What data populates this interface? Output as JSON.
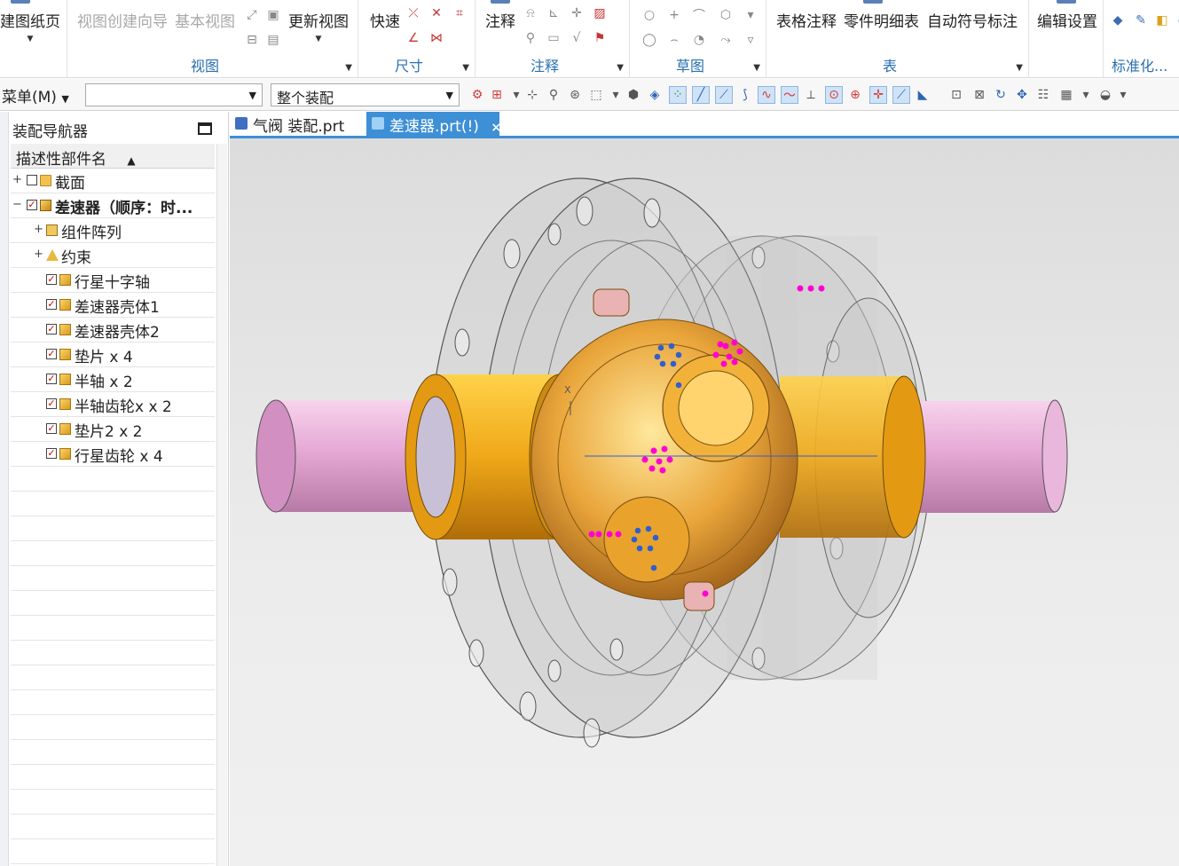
{
  "ribbon": {
    "groups": [
      {
        "label": "",
        "buttons": [
          "建图纸页"
        ]
      },
      {
        "label": "视图",
        "buttons": [
          "视图创建向导",
          "基本视图",
          "更新视图"
        ]
      },
      {
        "label": "尺寸",
        "buttons": [
          "快速"
        ]
      },
      {
        "label": "注释",
        "buttons": [
          "注释"
        ]
      },
      {
        "label": "草图",
        "buttons": []
      },
      {
        "label": "表",
        "buttons": [
          "表格注释",
          "零件明细表",
          "自动符号标注"
        ]
      },
      {
        "label": "",
        "buttons": [
          "编辑设置"
        ]
      },
      {
        "label": "标准化...",
        "buttons": []
      }
    ]
  },
  "toolbar": {
    "menu_label": "菜单(M)",
    "filter_value": "",
    "scope_value": "整个装配"
  },
  "navigator": {
    "title": "装配导航器",
    "column_header": "描述性部件名",
    "items": [
      {
        "label": "截面",
        "level": 0,
        "expander": "+",
        "checked": false,
        "icon": "folder",
        "bold": false
      },
      {
        "label": "差速器（顺序：时...",
        "level": 0,
        "expander": "−",
        "checked": true,
        "icon": "asm",
        "bold": true
      },
      {
        "label": "组件阵列",
        "level": 1,
        "expander": "+",
        "checked": null,
        "icon": "arr",
        "bold": false
      },
      {
        "label": "约束",
        "level": 1,
        "expander": "+",
        "checked": null,
        "icon": "cons",
        "bold": false
      },
      {
        "label": "行星十字轴",
        "level": 1,
        "expander": "",
        "checked": true,
        "icon": "cube",
        "bold": false
      },
      {
        "label": "差速器壳体1",
        "level": 1,
        "expander": "",
        "checked": true,
        "icon": "cube",
        "bold": false
      },
      {
        "label": "差速器壳体2",
        "level": 1,
        "expander": "",
        "checked": true,
        "icon": "cube",
        "bold": false
      },
      {
        "label": "垫片 x 4",
        "level": 1,
        "expander": "",
        "checked": true,
        "icon": "cube",
        "bold": false
      },
      {
        "label": "半轴 x 2",
        "level": 1,
        "expander": "",
        "checked": true,
        "icon": "cube",
        "bold": false
      },
      {
        "label": "半轴齿轮x x 2",
        "level": 1,
        "expander": "",
        "checked": true,
        "icon": "cube",
        "bold": false
      },
      {
        "label": "垫片2 x 2",
        "level": 1,
        "expander": "",
        "checked": true,
        "icon": "cube",
        "bold": false
      },
      {
        "label": "行星齿轮 x 4",
        "level": 1,
        "expander": "",
        "checked": true,
        "icon": "cube",
        "bold": false
      }
    ]
  },
  "tabs": [
    {
      "label": "气阀 装配.prt",
      "active": false
    },
    {
      "label": "差速器.prt(!)",
      "active": true,
      "close": "×"
    }
  ],
  "viewport": {
    "axis_label": "X"
  },
  "colors": {
    "accent": "#3d8fd6",
    "group_label": "#2a6fb0",
    "shaft": "#e6a9d6",
    "gear": "#f0a818",
    "point_magenta": "#ff00d4",
    "point_blue": "#2f5fd0"
  }
}
